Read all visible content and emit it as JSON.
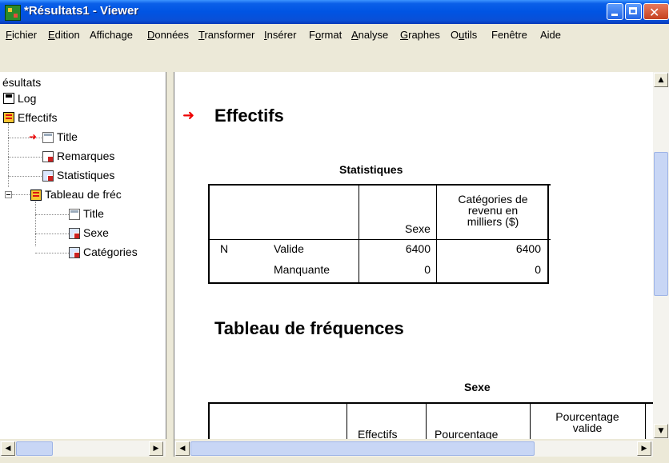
{
  "window": {
    "title": "*Résultats1 - Viewer"
  },
  "menu": [
    "Fichier",
    "Edition",
    "Affichage",
    "Données",
    "Transformer",
    "Insérer",
    "Format",
    "Analyse",
    "Graphes",
    "Outils",
    "Fenêtre",
    "Aide"
  ],
  "menu_underlines": [
    "F",
    "E",
    "",
    "D",
    "T",
    "I",
    "o",
    "A",
    "G",
    "u",
    "",
    ""
  ],
  "tree": {
    "root": "ésultats",
    "log": "Log",
    "effectifs": "Effectifs",
    "title1": "Title",
    "remarques": "Remarques",
    "statistiques": "Statistiques",
    "tableau": "Tableau de fréc",
    "title2": "Title",
    "sexe": "Sexe",
    "categories": "Catégories"
  },
  "content": {
    "heading1": "Effectifs",
    "stats_table": {
      "caption": "Statistiques",
      "col_sexe": "Sexe",
      "col_cat": [
        "Catégories de",
        "revenu en",
        "milliers ($)"
      ],
      "row_n": "N",
      "row_valide": "Valide",
      "row_manquante": "Manquante",
      "valide_sexe": "6400",
      "valide_cat": "6400",
      "manq_sexe": "0",
      "manq_cat": "0"
    },
    "heading2": "Tableau de fréquences",
    "freq_table": {
      "caption": "Sexe",
      "col_effectifs": "Effectifs",
      "col_pourcentage": "Pourcentage",
      "col_pct_valide": [
        "Pourcentage",
        "valide"
      ]
    }
  },
  "colors": {
    "title_bar": "#0054e3",
    "arrow": "#ee0000"
  }
}
